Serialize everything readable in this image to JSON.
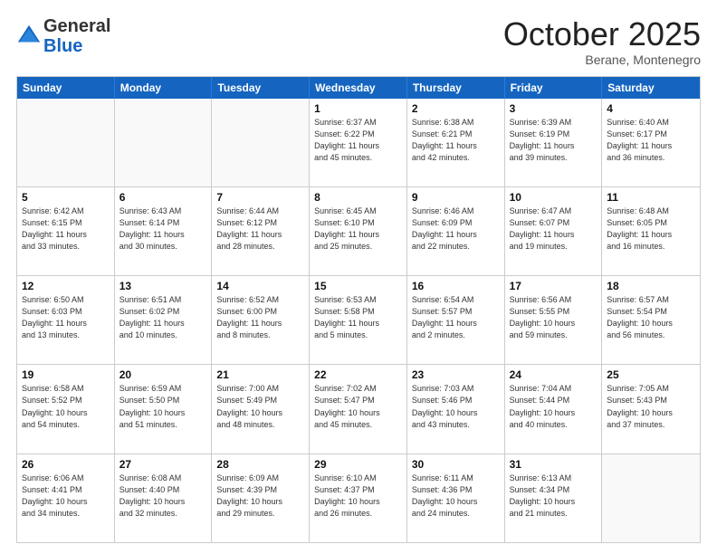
{
  "header": {
    "logo_general": "General",
    "logo_blue": "Blue",
    "month": "October 2025",
    "location": "Berane, Montenegro"
  },
  "days_of_week": [
    "Sunday",
    "Monday",
    "Tuesday",
    "Wednesday",
    "Thursday",
    "Friday",
    "Saturday"
  ],
  "weeks": [
    [
      {
        "day": "",
        "info": ""
      },
      {
        "day": "",
        "info": ""
      },
      {
        "day": "",
        "info": ""
      },
      {
        "day": "1",
        "info": "Sunrise: 6:37 AM\nSunset: 6:22 PM\nDaylight: 11 hours\nand 45 minutes."
      },
      {
        "day": "2",
        "info": "Sunrise: 6:38 AM\nSunset: 6:21 PM\nDaylight: 11 hours\nand 42 minutes."
      },
      {
        "day": "3",
        "info": "Sunrise: 6:39 AM\nSunset: 6:19 PM\nDaylight: 11 hours\nand 39 minutes."
      },
      {
        "day": "4",
        "info": "Sunrise: 6:40 AM\nSunset: 6:17 PM\nDaylight: 11 hours\nand 36 minutes."
      }
    ],
    [
      {
        "day": "5",
        "info": "Sunrise: 6:42 AM\nSunset: 6:15 PM\nDaylight: 11 hours\nand 33 minutes."
      },
      {
        "day": "6",
        "info": "Sunrise: 6:43 AM\nSunset: 6:14 PM\nDaylight: 11 hours\nand 30 minutes."
      },
      {
        "day": "7",
        "info": "Sunrise: 6:44 AM\nSunset: 6:12 PM\nDaylight: 11 hours\nand 28 minutes."
      },
      {
        "day": "8",
        "info": "Sunrise: 6:45 AM\nSunset: 6:10 PM\nDaylight: 11 hours\nand 25 minutes."
      },
      {
        "day": "9",
        "info": "Sunrise: 6:46 AM\nSunset: 6:09 PM\nDaylight: 11 hours\nand 22 minutes."
      },
      {
        "day": "10",
        "info": "Sunrise: 6:47 AM\nSunset: 6:07 PM\nDaylight: 11 hours\nand 19 minutes."
      },
      {
        "day": "11",
        "info": "Sunrise: 6:48 AM\nSunset: 6:05 PM\nDaylight: 11 hours\nand 16 minutes."
      }
    ],
    [
      {
        "day": "12",
        "info": "Sunrise: 6:50 AM\nSunset: 6:03 PM\nDaylight: 11 hours\nand 13 minutes."
      },
      {
        "day": "13",
        "info": "Sunrise: 6:51 AM\nSunset: 6:02 PM\nDaylight: 11 hours\nand 10 minutes."
      },
      {
        "day": "14",
        "info": "Sunrise: 6:52 AM\nSunset: 6:00 PM\nDaylight: 11 hours\nand 8 minutes."
      },
      {
        "day": "15",
        "info": "Sunrise: 6:53 AM\nSunset: 5:58 PM\nDaylight: 11 hours\nand 5 minutes."
      },
      {
        "day": "16",
        "info": "Sunrise: 6:54 AM\nSunset: 5:57 PM\nDaylight: 11 hours\nand 2 minutes."
      },
      {
        "day": "17",
        "info": "Sunrise: 6:56 AM\nSunset: 5:55 PM\nDaylight: 10 hours\nand 59 minutes."
      },
      {
        "day": "18",
        "info": "Sunrise: 6:57 AM\nSunset: 5:54 PM\nDaylight: 10 hours\nand 56 minutes."
      }
    ],
    [
      {
        "day": "19",
        "info": "Sunrise: 6:58 AM\nSunset: 5:52 PM\nDaylight: 10 hours\nand 54 minutes."
      },
      {
        "day": "20",
        "info": "Sunrise: 6:59 AM\nSunset: 5:50 PM\nDaylight: 10 hours\nand 51 minutes."
      },
      {
        "day": "21",
        "info": "Sunrise: 7:00 AM\nSunset: 5:49 PM\nDaylight: 10 hours\nand 48 minutes."
      },
      {
        "day": "22",
        "info": "Sunrise: 7:02 AM\nSunset: 5:47 PM\nDaylight: 10 hours\nand 45 minutes."
      },
      {
        "day": "23",
        "info": "Sunrise: 7:03 AM\nSunset: 5:46 PM\nDaylight: 10 hours\nand 43 minutes."
      },
      {
        "day": "24",
        "info": "Sunrise: 7:04 AM\nSunset: 5:44 PM\nDaylight: 10 hours\nand 40 minutes."
      },
      {
        "day": "25",
        "info": "Sunrise: 7:05 AM\nSunset: 5:43 PM\nDaylight: 10 hours\nand 37 minutes."
      }
    ],
    [
      {
        "day": "26",
        "info": "Sunrise: 6:06 AM\nSunset: 4:41 PM\nDaylight: 10 hours\nand 34 minutes."
      },
      {
        "day": "27",
        "info": "Sunrise: 6:08 AM\nSunset: 4:40 PM\nDaylight: 10 hours\nand 32 minutes."
      },
      {
        "day": "28",
        "info": "Sunrise: 6:09 AM\nSunset: 4:39 PM\nDaylight: 10 hours\nand 29 minutes."
      },
      {
        "day": "29",
        "info": "Sunrise: 6:10 AM\nSunset: 4:37 PM\nDaylight: 10 hours\nand 26 minutes."
      },
      {
        "day": "30",
        "info": "Sunrise: 6:11 AM\nSunset: 4:36 PM\nDaylight: 10 hours\nand 24 minutes."
      },
      {
        "day": "31",
        "info": "Sunrise: 6:13 AM\nSunset: 4:34 PM\nDaylight: 10 hours\nand 21 minutes."
      },
      {
        "day": "",
        "info": ""
      }
    ]
  ]
}
